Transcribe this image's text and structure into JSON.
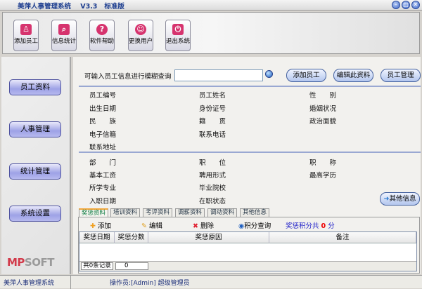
{
  "window": {
    "title": "美萍人事管理系统    V3.3   标准版",
    "min": "–",
    "max": "□",
    "close": "✕"
  },
  "toolbar": [
    {
      "label": "添加员工",
      "icon": "add-user-icon",
      "glyph": "♙"
    },
    {
      "label": "信息统计",
      "icon": "search-icon",
      "glyph": "⌕"
    },
    {
      "label": "软件帮助",
      "icon": "help-icon",
      "glyph": "?"
    },
    {
      "label": "更换用户",
      "icon": "switch-user-icon",
      "glyph": "☺"
    },
    {
      "label": "退出系统",
      "icon": "power-icon",
      "glyph": "⏻"
    }
  ],
  "sidebar": {
    "items": [
      "员工资料",
      "人事管理",
      "统计管理",
      "系统设置"
    ],
    "logo": "MPSOFT",
    "status": "美萍人事管理系统"
  },
  "search": {
    "label": "可输入员工信息进行模糊查询",
    "value": ""
  },
  "actions": {
    "add": "添加员工",
    "edit": "编辑此资料",
    "manage": "员工管理",
    "other": "其他信息"
  },
  "fields1": [
    [
      "员工编号",
      "员工姓名",
      "性　　别"
    ],
    [
      "出生日期",
      "身份证号",
      "婚姻状况"
    ],
    [
      "民　　族",
      "籍　　贯",
      "政治面貌"
    ],
    [
      "电子信箱",
      "联系电话",
      ""
    ],
    [
      "联系地址",
      "",
      ""
    ]
  ],
  "fields2": [
    [
      "部　　门",
      "职　　位",
      "职　　称"
    ],
    [
      "基本工资",
      "聘用形式",
      "最高学历"
    ],
    [
      "所学专业",
      "毕业院校",
      ""
    ],
    [
      "入职日期",
      "在职状态",
      ""
    ]
  ],
  "tabs": [
    "奖惩资料",
    "培训资料",
    "考评资料",
    "调薪资料",
    "调动资料",
    "其他信息"
  ],
  "subtoolbar": {
    "add": "添加",
    "edit": "编辑",
    "delete": "删除",
    "query": "积分查询",
    "total_prefix": "奖惩积分共",
    "total_value": "0",
    "total_suffix": "分"
  },
  "grid": {
    "columns": [
      "奖惩日期",
      "奖惩分数",
      "奖惩原因",
      "备注"
    ],
    "rows": [],
    "record_label": "共0条记录",
    "record_value": "0"
  },
  "statusbar": {
    "operator": "操作员:[Admin] 超级管理员"
  }
}
